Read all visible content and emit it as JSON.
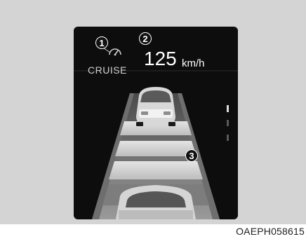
{
  "cluster": {
    "cruise_label": "CRUISE",
    "speed_value": "125",
    "speed_unit": "km/h"
  },
  "callouts": [
    "1",
    "2",
    "3"
  ],
  "image_code": "OAEPH058615",
  "icons": {
    "cruise": "speedometer-icon",
    "vehicle_ahead": "car-rear-icon",
    "own_vehicle": "car-icon"
  },
  "colors": {
    "background": "#d4d4d4",
    "display": "#0d0d0d",
    "text": "#ffffff",
    "road_gray": "#8a8a8a"
  }
}
